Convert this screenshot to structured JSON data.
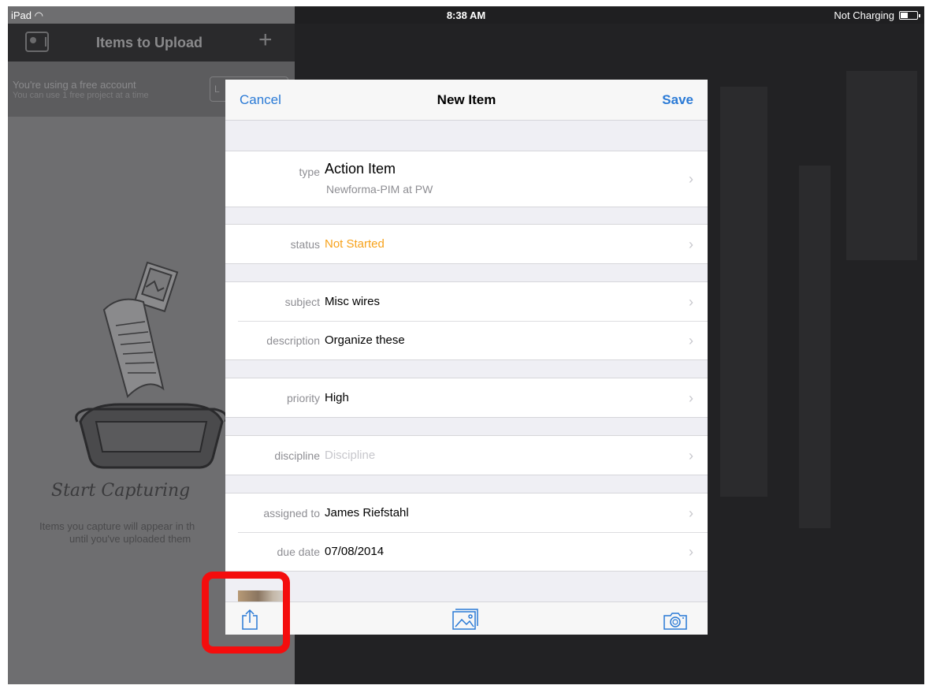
{
  "status_bar": {
    "device": "iPad",
    "time": "8:38 AM",
    "charging": "Not Charging"
  },
  "master": {
    "title": "Items to Upload",
    "account_line1": "You're using a free account",
    "account_line2": "You can use 1 free project at a time",
    "account_button": "L",
    "capture_heading": "Start Capturing",
    "capture_text1": "Items you capture will appear in th",
    "capture_text2": "until you've uploaded them"
  },
  "modal": {
    "cancel": "Cancel",
    "title": "New Item",
    "save": "Save",
    "type": {
      "label": "type",
      "value": "Action Item",
      "sub": "Newforma-PIM at PW"
    },
    "status": {
      "label": "status",
      "value": "Not Started"
    },
    "subject": {
      "label": "subject",
      "value": "Misc wires"
    },
    "description": {
      "label": "description",
      "value": "Organize these"
    },
    "priority": {
      "label": "priority",
      "value": "High"
    },
    "discipline": {
      "label": "discipline",
      "placeholder": "Discipline"
    },
    "assigned_to": {
      "label": "assigned to",
      "value": "James Riefstahl"
    },
    "due_date": {
      "label": "due date",
      "value": "07/08/2014"
    },
    "chevron": "›"
  },
  "colors": {
    "accent": "#2a7ad6",
    "status_orange": "#f7a21b",
    "highlight": "#f40d0d"
  },
  "icons": [
    "wifi-icon",
    "battery-icon",
    "id-card-icon",
    "add-icon",
    "chevron-right-icon",
    "share-icon",
    "photo-library-icon",
    "camera-icon"
  ]
}
